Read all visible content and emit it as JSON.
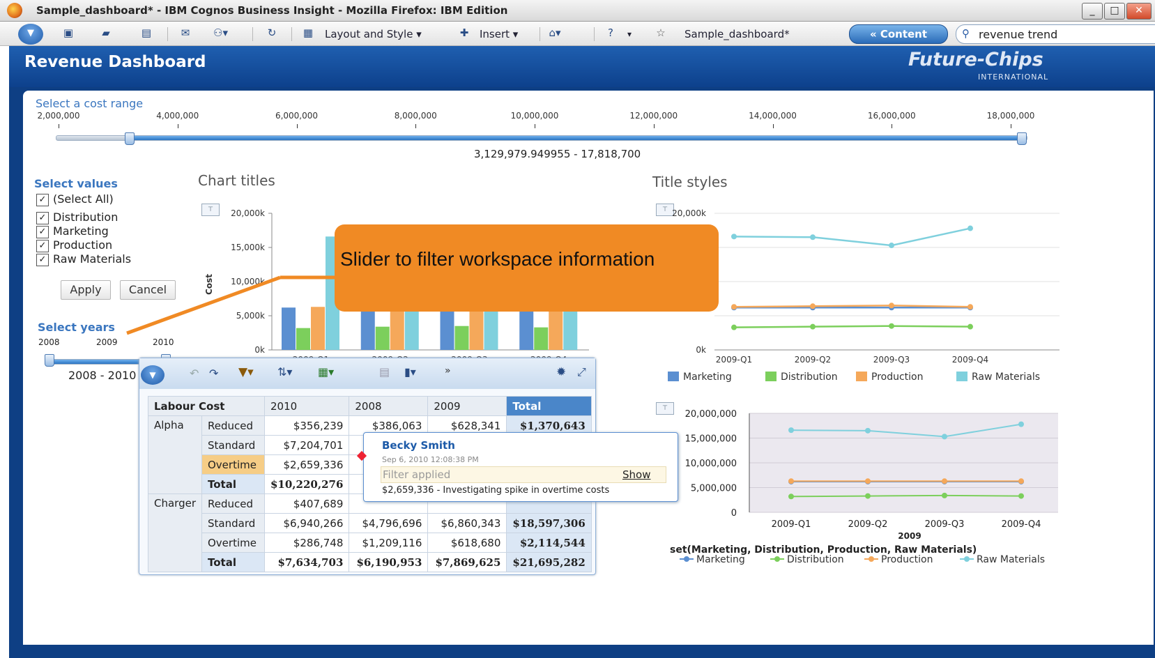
{
  "window": {
    "title": "Sample_dashboard* - IBM Cognos Business Insight - Mozilla Firefox: IBM Edition",
    "minimize": "_",
    "maximize": "□",
    "close": "✕"
  },
  "toolbar": {
    "layout_style": "Layout and Style",
    "insert": "Insert",
    "dashboard_name": "Sample_dashboard*",
    "content_btn": "« Content",
    "search_value": "revenue trend"
  },
  "header": {
    "title": "Revenue Dashboard",
    "brand": "Future-Chips",
    "brand_sub": "INTERNATIONAL"
  },
  "cost_slider": {
    "label": "Select a cost range",
    "ticks": [
      "2,000,000",
      "4,000,000",
      "6,000,000",
      "8,000,000",
      "10,000,000",
      "12,000,000",
      "14,000,000",
      "16,000,000",
      "18,000,000"
    ],
    "range_text": "3,129,979.949955 - 17,818,700",
    "selected_min": 3129979.949955,
    "selected_max": 17818700
  },
  "values_filter": {
    "label": "Select values",
    "items": [
      "(Select All)",
      "Distribution",
      "Marketing",
      "Production",
      "Raw Materials"
    ],
    "apply": "Apply",
    "cancel": "Cancel"
  },
  "years_slider": {
    "label": "Select years",
    "ticks": [
      "2008",
      "2009",
      "2010"
    ],
    "range_text": "2008 - 2010"
  },
  "callout": {
    "text": "Slider to filter workspace information"
  },
  "colors": {
    "marketing": "#5b8fd1",
    "distribution": "#7ccf5c",
    "production": "#f5a85a",
    "raw_materials": "#7fd0dd"
  },
  "chart_data": [
    {
      "type": "bar",
      "title": "Chart titles",
      "ylabel": "Cost",
      "categories": [
        "2009-Q1",
        "2009-Q2",
        "2009-Q3",
        "2009-Q4"
      ],
      "yticks": [
        "0k",
        "5,000k",
        "10,000k",
        "15,000k",
        "20,000k"
      ],
      "ylim": [
        0,
        20000
      ],
      "series": [
        {
          "name": "Marketing",
          "values": [
            6200,
            6300,
            6200,
            6200
          ]
        },
        {
          "name": "Distribution",
          "values": [
            3200,
            3400,
            3500,
            3300
          ]
        },
        {
          "name": "Production",
          "values": [
            6300,
            6300,
            6300,
            6300
          ]
        },
        {
          "name": "Raw Materials",
          "values": [
            16600,
            16500,
            15300,
            17800
          ]
        }
      ]
    },
    {
      "type": "line",
      "title": "Title styles",
      "categories": [
        "2009-Q1",
        "2009-Q2",
        "2009-Q3",
        "2009-Q4"
      ],
      "yticks": [
        "0k",
        "20,000k"
      ],
      "ylim": [
        0,
        20000
      ],
      "legend": [
        "Marketing",
        "Distribution",
        "Production",
        "Raw Materials"
      ],
      "series": [
        {
          "name": "Marketing",
          "values": [
            6200,
            6200,
            6200,
            6200
          ]
        },
        {
          "name": "Distribution",
          "values": [
            3300,
            3400,
            3500,
            3400
          ]
        },
        {
          "name": "Production",
          "values": [
            6300,
            6400,
            6500,
            6300
          ]
        },
        {
          "name": "Raw Materials",
          "values": [
            16600,
            16500,
            15300,
            17800
          ]
        }
      ]
    },
    {
      "type": "line",
      "categories": [
        "2009-Q1",
        "2009-Q2",
        "2009-Q3",
        "2009-Q4"
      ],
      "xlabel": "2009",
      "yticks": [
        "0",
        "5,000,000",
        "10,000,000",
        "15,000,000",
        "20,000,000"
      ],
      "ylim": [
        0,
        20000000
      ],
      "series_label": "set(Marketing, Distribution, Production, Raw Materials)",
      "legend": [
        "Marketing",
        "Distribution",
        "Production",
        "Raw Materials"
      ],
      "series": [
        {
          "name": "Marketing",
          "values": [
            6200000,
            6200000,
            6200000,
            6200000
          ]
        },
        {
          "name": "Distribution",
          "values": [
            3200000,
            3300000,
            3400000,
            3300000
          ]
        },
        {
          "name": "Production",
          "values": [
            6300000,
            6300000,
            6300000,
            6300000
          ]
        },
        {
          "name": "Raw Materials",
          "values": [
            16600000,
            16500000,
            15300000,
            17800000
          ]
        }
      ]
    }
  ],
  "crosstab": {
    "corner": "Labour Cost",
    "columns": [
      "2010",
      "2008",
      "2009",
      "Total"
    ],
    "rows": [
      {
        "group": "Alpha",
        "type": "Reduced",
        "v": [
          "$356,239",
          "$386,063",
          "$628,341",
          "$1,370,643"
        ]
      },
      {
        "group": "",
        "type": "Standard",
        "v": [
          "$7,204,701",
          "$7",
          "",
          ""
        ]
      },
      {
        "group": "",
        "type": "Overtime",
        "v": [
          "$2,659,336",
          "",
          "",
          ""
        ]
      },
      {
        "group": "",
        "type": "Total",
        "v": [
          "$10,220,276",
          "$9",
          "",
          ""
        ]
      },
      {
        "group": "Charger",
        "type": "Reduced",
        "v": [
          "$407,689",
          "",
          "",
          ""
        ]
      },
      {
        "group": "",
        "type": "Standard",
        "v": [
          "$6,940,266",
          "$4,796,696",
          "$6,860,343",
          "$18,597,306"
        ]
      },
      {
        "group": "",
        "type": "Overtime",
        "v": [
          "$286,748",
          "$1,209,116",
          "$618,680",
          "$2,114,544"
        ]
      },
      {
        "group": "",
        "type": "Total",
        "v": [
          "$7,634,703",
          "$6,190,953",
          "$7,869,625",
          "$21,695,282"
        ]
      }
    ]
  },
  "comment": {
    "author": "Becky Smith",
    "date": "Sep 6, 2010 12:08:38 PM",
    "filter": "Filter applied",
    "show": "Show",
    "text": "$2,659,336 - Investigating spike in overtime costs"
  }
}
